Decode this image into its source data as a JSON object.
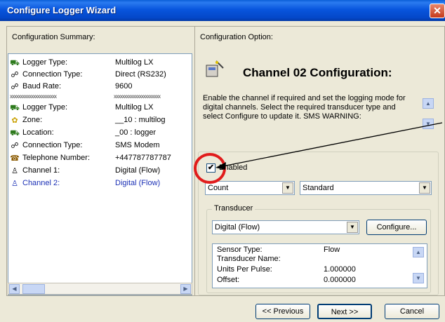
{
  "window": {
    "title": "Configure Logger Wizard"
  },
  "left": {
    "heading": "Configuration Summary:",
    "rows": [
      {
        "icon": "logger-icon",
        "label": "Logger Type:",
        "value": "Multilog LX"
      },
      {
        "icon": "connection-icon",
        "label": "Connection Type:",
        "value": "Direct (RS232)"
      },
      {
        "icon": "connection-icon",
        "label": "Baud Rate:",
        "value": "9600"
      },
      {
        "icon": "logger-icon",
        "label": "Logger Type:",
        "value": "Multilog LX"
      },
      {
        "icon": "zone-icon",
        "label": "Zone:",
        "value": "__10 : multilog"
      },
      {
        "icon": "logger-icon",
        "label": "Location:",
        "value": "_00 : logger"
      },
      {
        "icon": "connection-icon",
        "label": "Connection Type:",
        "value": "SMS Modem"
      },
      {
        "icon": "telephone-icon",
        "label": "Telephone Number:",
        "value": "+447787787787"
      },
      {
        "icon": "channel-icon",
        "label": "Channel 1:",
        "value": "Digital (Flow)"
      },
      {
        "icon": "channel-icon",
        "label": "Channel 2:",
        "value": "Digital (Flow)"
      }
    ],
    "separator": "xxxxxxxxxxxxxxxxxxxxxx"
  },
  "right": {
    "heading": "Configuration Option:",
    "channel_title": "Channel 02 Configuration:",
    "description": "Enable the channel if required and set the logging mode for digital channels. Select the required transducer type and select Configure to update it. SMS WARNING:",
    "enabled_label": "Enabled",
    "enabled_checked": true,
    "mode_value": "Count",
    "type_value": "Standard",
    "transducer_legend": "Transducer",
    "transducer_value": "Digital (Flow)",
    "configure_label": "Configure...",
    "properties": [
      {
        "label": "Sensor Type:",
        "value": "Flow"
      },
      {
        "label": "Transducer Name:",
        "value": ""
      },
      {
        "label": "Units Per Pulse:",
        "value": "1.000000"
      },
      {
        "label": "Offset:",
        "value": "0.000000"
      }
    ]
  },
  "footer": {
    "previous_label": "<< Previous",
    "next_label": "Next >>",
    "cancel_label": "Cancel"
  },
  "colors": {
    "title_bar": "#0553d8",
    "highlight": "#e11c1c",
    "link_blue": "#1a2fb5"
  }
}
